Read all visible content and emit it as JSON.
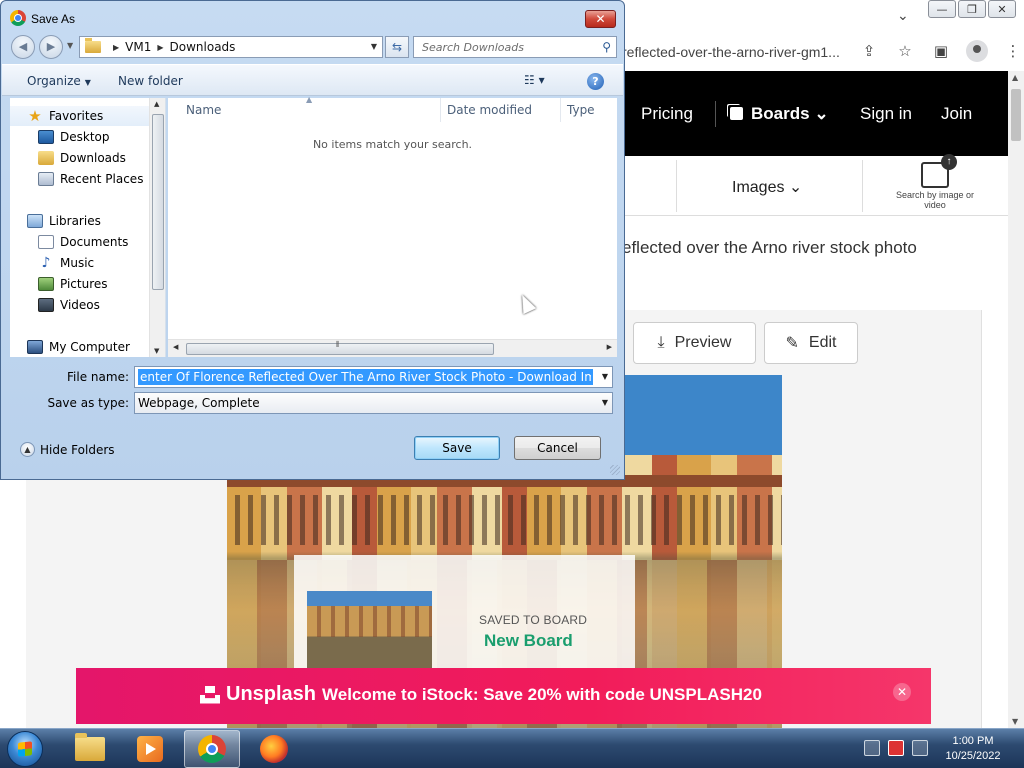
{
  "browser": {
    "url_fragment": "reflected-over-the-arno-river-gm1...",
    "window_controls": {
      "minimize": "—",
      "restore": "❐",
      "close": "✕"
    }
  },
  "site": {
    "nav": {
      "pricing": "Pricing",
      "boards": "Boards",
      "sign_in": "Sign in",
      "join": "Join"
    },
    "search": {
      "images_label": "Images",
      "search_by_image": "Search by image or video"
    },
    "photo_title": "eflected over the Arno river stock photo",
    "actions": {
      "preview": "Preview",
      "edit": "Edit"
    },
    "toast": {
      "label": "SAVED TO BOARD",
      "board_name": "New Board"
    },
    "promo": {
      "logo": "Unsplash",
      "message": "Welcome to iStock: Save 20% with code UNSPLASH20"
    }
  },
  "dialog": {
    "title": "Save As",
    "breadcrumb": [
      "VM1",
      "Downloads"
    ],
    "search_placeholder": "Search Downloads",
    "toolbar": {
      "organize": "Organize",
      "new_folder": "New folder"
    },
    "nav_items": [
      {
        "label": "Favorites",
        "icon": "star-icon"
      },
      {
        "label": "Desktop",
        "icon": "desktop-icon"
      },
      {
        "label": "Downloads",
        "icon": "downloads-folder-icon"
      },
      {
        "label": "Recent Places",
        "icon": "recent-places-icon"
      },
      {
        "label": "Libraries",
        "icon": "libraries-icon"
      },
      {
        "label": "Documents",
        "icon": "documents-icon"
      },
      {
        "label": "Music",
        "icon": "music-icon"
      },
      {
        "label": "Pictures",
        "icon": "pictures-icon"
      },
      {
        "label": "Videos",
        "icon": "videos-icon"
      },
      {
        "label": "My Computer",
        "icon": "computer-icon"
      }
    ],
    "columns": [
      "Name",
      "Date modified",
      "Type"
    ],
    "empty_message": "No items match your search.",
    "file_name_label": "File name:",
    "file_name_value": "enter Of Florence Reflected Over The Arno River Stock Photo - Download Image Now -",
    "save_as_type_label": "Save as type:",
    "save_as_type_value": "Webpage, Complete",
    "hide_folders": "Hide Folders",
    "save_button": "Save",
    "cancel_button": "Cancel"
  },
  "taskbar": {
    "clock_time": "1:00 PM",
    "clock_date": "10/25/2022"
  },
  "colors": {
    "promo_pink": "#e4166a",
    "board_green": "#1a9e6e",
    "dialog_blue": "#b9d1ec",
    "selection_blue": "#3399ff"
  }
}
